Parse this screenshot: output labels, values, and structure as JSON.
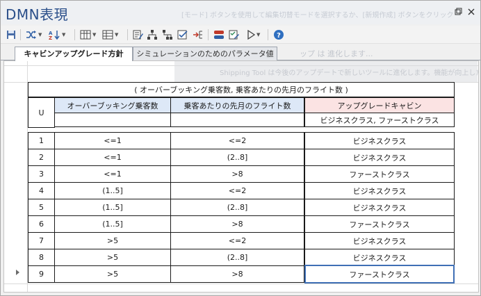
{
  "window": {
    "title": "DMN表現",
    "ghost_text": "[モード] ボタンを使用して編集切替モードを選択するか、[新規作成] ボタンをクリック",
    "ghost_text_2": "ップ は 進化します...",
    "ghost_text_3": "Shipping Tool は今後のアップデートで新しいツールに進化します。機能が向上した切り"
  },
  "toolbar": {
    "icons": [
      "save-icon",
      "shuffle-icon",
      "sort-az-icon",
      "insert-column-icon",
      "insert-row-icon",
      "edit-icon",
      "hierarchy-icon",
      "hierarchy-2-icon",
      "validate-icon",
      "expand-icon",
      "simulation-icon",
      "checklist-icon",
      "play-icon",
      "help-icon"
    ]
  },
  "tabs": [
    {
      "label": "キャビンアップグレード方針",
      "active": true
    },
    {
      "label": "シミュレーションのためのパラメータ値",
      "active": false
    }
  ],
  "decision_table": {
    "caption": "( オーバーブッキング乗客数, 乗客あたりの先月のフライト数 )",
    "hit_policy": "U",
    "inputs": [
      {
        "label": "オーバーブッキング乗客数",
        "values": ""
      },
      {
        "label": "乗客あたりの先月のフライト数",
        "values": ""
      }
    ],
    "output": {
      "label": "アップグレードキャビン",
      "values": "ビジネスクラス, ファーストクラス"
    },
    "rows": [
      {
        "n": "1",
        "in1": "<=1",
        "in2": "<=2",
        "out": "ビジネスクラス"
      },
      {
        "n": "2",
        "in1": "<=1",
        "in2": "(2..8]",
        "out": "ビジネスクラス"
      },
      {
        "n": "3",
        "in1": "<=1",
        "in2": ">8",
        "out": "ファーストクラス"
      },
      {
        "n": "4",
        "in1": "(1..5]",
        "in2": "<=2",
        "out": "ビジネスクラス"
      },
      {
        "n": "5",
        "in1": "(1..5]",
        "in2": "(2..8]",
        "out": "ビジネスクラス"
      },
      {
        "n": "6",
        "in1": "(1..5]",
        "in2": ">8",
        "out": "ファーストクラス"
      },
      {
        "n": "7",
        "in1": ">5",
        "in2": "<=2",
        "out": "ビジネスクラス"
      },
      {
        "n": "8",
        "in1": ">5",
        "in2": "(2..8]",
        "out": "ビジネスクラス"
      },
      {
        "n": "9",
        "in1": ">5",
        "in2": ">8",
        "out": "ファーストクラス"
      }
    ]
  },
  "colors": {
    "input_header": "#dde8f7",
    "output_header": "#fbe3e3",
    "title": "#2b4f8a",
    "selection": "#3f6fb5"
  }
}
